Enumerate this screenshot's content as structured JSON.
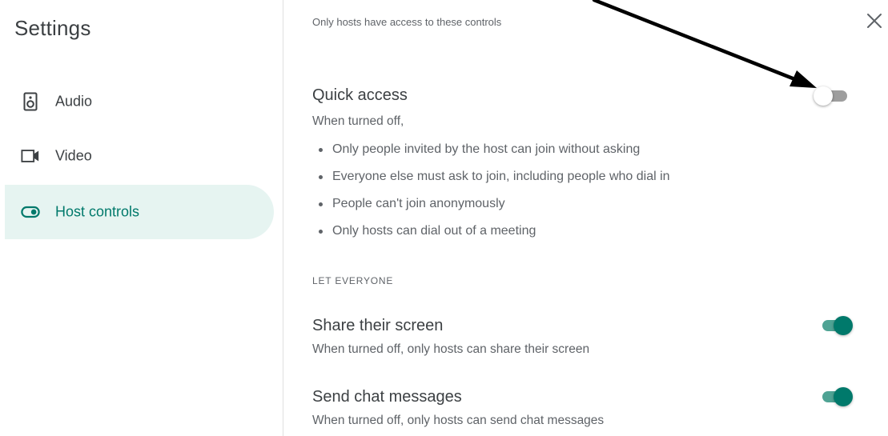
{
  "sidebar": {
    "title": "Settings",
    "items": [
      {
        "label": "Audio",
        "icon": "speaker-icon",
        "active": false
      },
      {
        "label": "Video",
        "icon": "video-camera-icon",
        "active": false
      },
      {
        "label": "Host controls",
        "icon": "toggle-icon",
        "active": true
      }
    ]
  },
  "main": {
    "hint": "Only hosts have access to these controls",
    "close_icon": "close-icon",
    "quick_access": {
      "title": "Quick access",
      "description": "When turned off,",
      "bullets": [
        "Only people invited by the host can join without asking",
        "Everyone else must ask to join, including people who dial in",
        "People can't join anonymously",
        "Only hosts can dial out of a meeting"
      ],
      "enabled": false
    },
    "section_label": "LET EVERYONE",
    "share_screen": {
      "title": "Share their screen",
      "description": "When turned off, only hosts can share their screen",
      "enabled": true
    },
    "chat": {
      "title": "Send chat messages",
      "description": "When turned off, only hosts can send chat messages",
      "enabled": true
    }
  },
  "colors": {
    "accent": "#00796b",
    "accent_track": "#4fa394",
    "active_bg": "#e6f4f1",
    "text_primary": "#3c4043",
    "text_secondary": "#5f6368"
  }
}
